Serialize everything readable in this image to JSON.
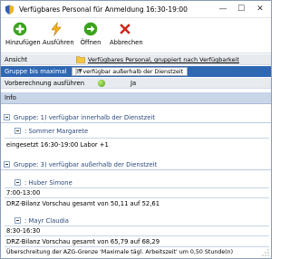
{
  "window": {
    "title": "Verfügbares Personal für Anmeldung 16:30-19:00"
  },
  "toolbar": {
    "hinzufuegen": "Hinzufügen",
    "ausfuehren": "Ausführen",
    "oeffnen": "Öffnen",
    "abbrechen": "Abbrechen"
  },
  "props": {
    "ansicht_label": "Ansicht",
    "ansicht_value": "Verfügbares Personal, gruppiert nach Verfügbarkeit",
    "gruppe_label": "Gruppe bis maximal",
    "gruppe_value": "3) verfügbar außerhalb der Dienstzeit",
    "vorb_label": "Vorberechnung ausführen",
    "vorb_value": "Ja"
  },
  "info": {
    "header": "Info",
    "groups": [
      {
        "title": "Gruppe: 1) verfügbar innerhalb der Dienstzeit",
        "persons": [
          {
            "name": ": Sommer Margarete",
            "lines": [
              "eingesetzt 16:30-19:00 Labor +1"
            ]
          }
        ]
      },
      {
        "title": "Gruppe: 3) verfügbar außerhalb der Dienstzeit",
        "persons": [
          {
            "name": ": Huber Simone",
            "lines": [
              "7:00-13:00",
              "DRZ-Bilanz Vorschau gesamt von 50,11 auf 52,61"
            ]
          },
          {
            "name": ": Mayr Claudia",
            "lines": [
              "8:30-16:30",
              "DRZ-Bilanz Vorschau gesamt von 65,79 auf 68,29",
              "Überschreitung der AZG-Grenze 'Maximale tägl. Arbeitszeit' um 0,50 Stunde(n)"
            ]
          }
        ]
      }
    ]
  }
}
